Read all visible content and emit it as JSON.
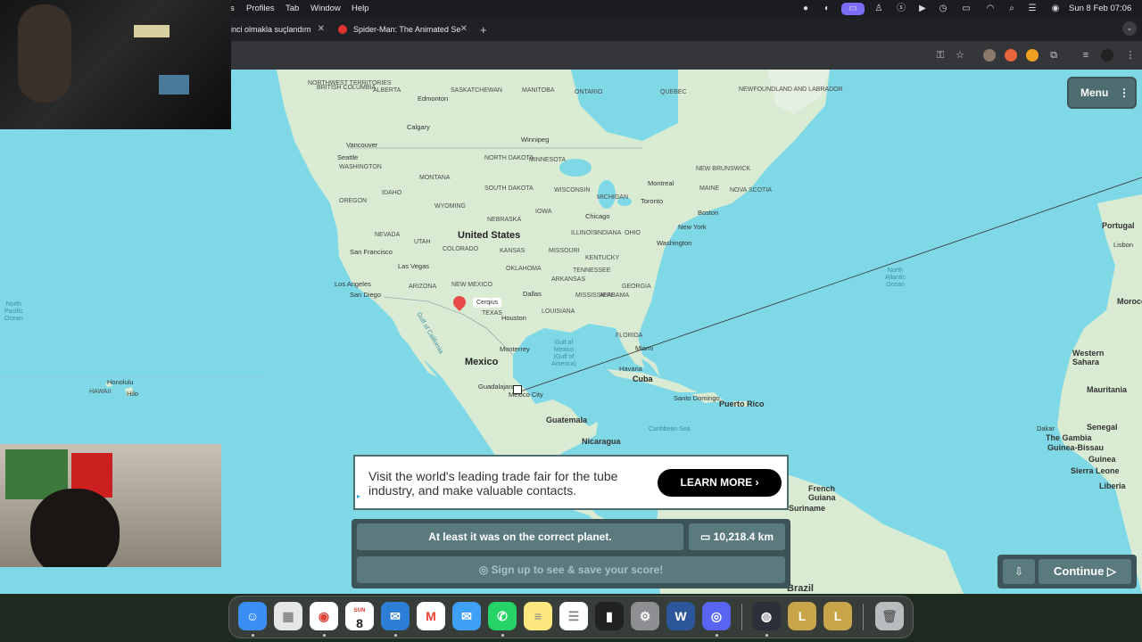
{
  "menubar": {
    "items": [
      "s",
      "Profiles",
      "Tab",
      "Window",
      "Help"
    ],
    "clock": "Sun 8 Feb  07:06"
  },
  "browser": {
    "tabs": [
      {
        "label": "inci olmakla suçlandım"
      },
      {
        "label": "Spider-Man: The Animated Se"
      }
    ],
    "new_tab": "+"
  },
  "map": {
    "countries": [
      "United States",
      "Mexico",
      "Cuba"
    ],
    "places": [
      "Edmonton",
      "Calgary",
      "Vancouver",
      "Winnipeg",
      "Seattle",
      "Montreal",
      "Toronto",
      "Boston",
      "New York",
      "Chicago",
      "Washington",
      "San Francisco",
      "Las Vegas",
      "Los Angeles",
      "San Diego",
      "Dallas",
      "Houston",
      "Monterrey",
      "Miami",
      "Havana",
      "Guadalajara",
      "Mexico City",
      "Guatemala",
      "Nicaragua",
      "Santo Domingo",
      "Puerto Rico",
      "Honolulu",
      "Hilo",
      "Portugal",
      "Lisbon",
      "Western Sahara",
      "Mauritania",
      "Senegal",
      "Dakar",
      "The Gambia",
      "Guinea-Bissau",
      "Guinea",
      "Sierra Leone",
      "Liberia",
      "Brazil",
      "French Guiana",
      "Suriname",
      "Morocco"
    ],
    "regions": [
      "NORTHWEST TERRITORIES",
      "ALBERTA",
      "BRITISH COLUMBIA",
      "SASKATCHEWAN",
      "MANITOBA",
      "ONTARIO",
      "QUEBEC",
      "NEWFOUNDLAND AND LABRADOR",
      "WASHINGTON",
      "OREGON",
      "IDAHO",
      "MONTANA",
      "WYOMING",
      "NORTH DAKOTA",
      "SOUTH DAKOTA",
      "NEBRASKA",
      "MINNESOTA",
      "IOWA",
      "WISCONSIN",
      "MICHIGAN",
      "ILLINOIS",
      "INDIANA",
      "OHIO",
      "NEVADA",
      "UTAH",
      "COLORADO",
      "KANSAS",
      "MISSOURI",
      "KENTUCKY",
      "TENNESSEE",
      "ARIZONA",
      "NEW MEXICO",
      "OKLAHOMA",
      "ARKANSAS",
      "MISSISSIPPI",
      "ALABAMA",
      "GEORGIA",
      "LOUISIANA",
      "FLORIDA",
      "TEXAS",
      "MAINE",
      "NOVA SCOTIA",
      "NEW BRUNSWICK",
      "HAWAII"
    ],
    "oceans": {
      "pacific": "North\nPacific\nOcean",
      "atlantic": "North\nAtlantic\nOcean",
      "gulf": "Gulf of\nMexico\n(Gulf of\nAmerica)",
      "caribbean": "Caribbean Sea",
      "gulf_california": "Gulf of California"
    },
    "guess_label": "Cerqius"
  },
  "menu_button": {
    "label": "Menu"
  },
  "ad": {
    "text": "Visit the world's leading trade fair for the tube industry, and make valuable contacts.",
    "cta": "LEARN MORE"
  },
  "result": {
    "message": "At least it was on the correct planet.",
    "distance": "10,218.4 km",
    "signup": "Sign up to see & save your score!"
  },
  "continue_button": {
    "label": "Continue"
  },
  "dock": {
    "calendar_month": "SUN",
    "calendar_day": "8"
  },
  "colors": {
    "panel": "#3c5457",
    "panel_btn": "#5a7a7d",
    "water": "#7fd8e6",
    "land": "#d8ecd2",
    "marker": "#e84a4a"
  }
}
